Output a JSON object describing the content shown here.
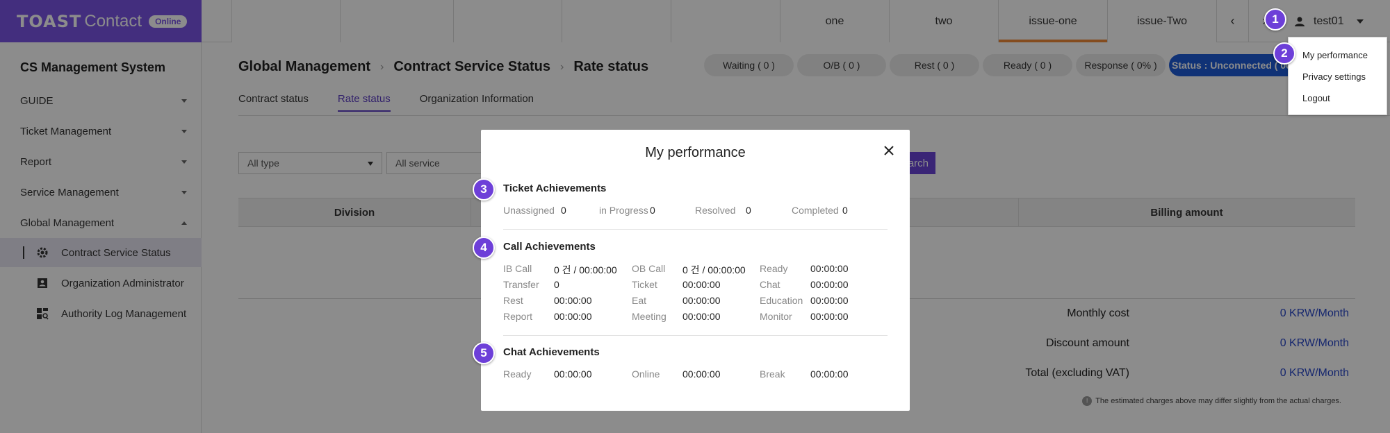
{
  "brand": {
    "name_bold": "TOAST",
    "name": "Contact",
    "badge": "Online"
  },
  "tabs": [
    {
      "label": ""
    },
    {
      "label": ""
    },
    {
      "label": ""
    },
    {
      "label": ""
    },
    {
      "label": ""
    },
    {
      "label": "one"
    },
    {
      "label": "two"
    },
    {
      "label": "issue-one"
    },
    {
      "label": "issue-Two"
    }
  ],
  "tab_nav": {
    "prev": "‹",
    "next": "›"
  },
  "user": {
    "name": "test01"
  },
  "sidebar": {
    "title": "CS Management System",
    "menu": [
      {
        "label": "GUIDE"
      },
      {
        "label": "Ticket Management"
      },
      {
        "label": "Report"
      },
      {
        "label": "Service Management"
      },
      {
        "label": "Global Management"
      }
    ],
    "sub": [
      {
        "label": "Contract Service Status",
        "icon": "gear-icon"
      },
      {
        "label": "Organization Administrator",
        "icon": "contact-card-icon"
      },
      {
        "label": "Authority Log Management",
        "icon": "dashboard-search-icon"
      }
    ]
  },
  "breadcrumb": [
    "Global Management",
    "Contract Service Status",
    "Rate status"
  ],
  "status": [
    "Waiting ( 0 )",
    "O/B ( 0 )",
    "Rest ( 0 )",
    "Ready ( 0 )",
    "Response ( 0% )",
    "Status : Unconnected ( 00:"
  ],
  "subtabs": [
    "Contract status",
    "Rate status",
    "Organization Information"
  ],
  "filters": {
    "type": "All type",
    "service": "All service",
    "search": "arch"
  },
  "table": {
    "headers": [
      "Division",
      "Billing amount"
    ]
  },
  "summary": [
    {
      "label": "Monthly cost",
      "value": "0 KRW/Month"
    },
    {
      "label": "Discount amount",
      "value": "0 KRW/Month"
    },
    {
      "label": "Total (excluding VAT)",
      "value": "0 KRW/Month"
    }
  ],
  "note": {
    "icon": "!",
    "text": "The estimated charges above may differ slightly from the actual charges."
  },
  "dropdown": [
    "My performance",
    "Privacy settings",
    "Logout"
  ],
  "modal": {
    "title": "My performance",
    "ticket": {
      "title": "Ticket Achievements",
      "items": [
        {
          "label": "Unassigned",
          "value": "0"
        },
        {
          "label": "in Progress",
          "value": "0"
        },
        {
          "label": "Resolved",
          "value": "0"
        },
        {
          "label": "Completed",
          "value": "0"
        }
      ]
    },
    "call": {
      "title": "Call Achievements",
      "rows": [
        [
          {
            "label": "IB Call",
            "value": "0 건 / 00:00:00"
          },
          {
            "label": "OB Call",
            "value": "0 건 / 00:00:00"
          },
          {
            "label": "Ready",
            "value": "00:00:00"
          }
        ],
        [
          {
            "label": "Transfer",
            "value": "0"
          },
          {
            "label": "Ticket",
            "value": "00:00:00"
          },
          {
            "label": "Chat",
            "value": "00:00:00"
          }
        ],
        [
          {
            "label": "Rest",
            "value": "00:00:00"
          },
          {
            "label": "Eat",
            "value": "00:00:00"
          },
          {
            "label": "Education",
            "value": "00:00:00"
          }
        ],
        [
          {
            "label": "Report",
            "value": "00:00:00"
          },
          {
            "label": "Meeting",
            "value": "00:00:00"
          },
          {
            "label": "Monitor",
            "value": "00:00:00"
          }
        ]
      ]
    },
    "chat": {
      "title": "Chat Achievements",
      "items": [
        {
          "label": "Ready",
          "value": "00:00:00"
        },
        {
          "label": "Online",
          "value": "00:00:00"
        },
        {
          "label": "Break",
          "value": "00:00:00"
        }
      ]
    }
  },
  "badges": [
    "1",
    "2",
    "3",
    "4",
    "5"
  ],
  "colors": {
    "brand": "#7a55e6",
    "badge": "#6d3fd8",
    "accent_tab": "#f08a3a",
    "link_value": "#2947c8",
    "status_blue": "#1e5bd8"
  }
}
